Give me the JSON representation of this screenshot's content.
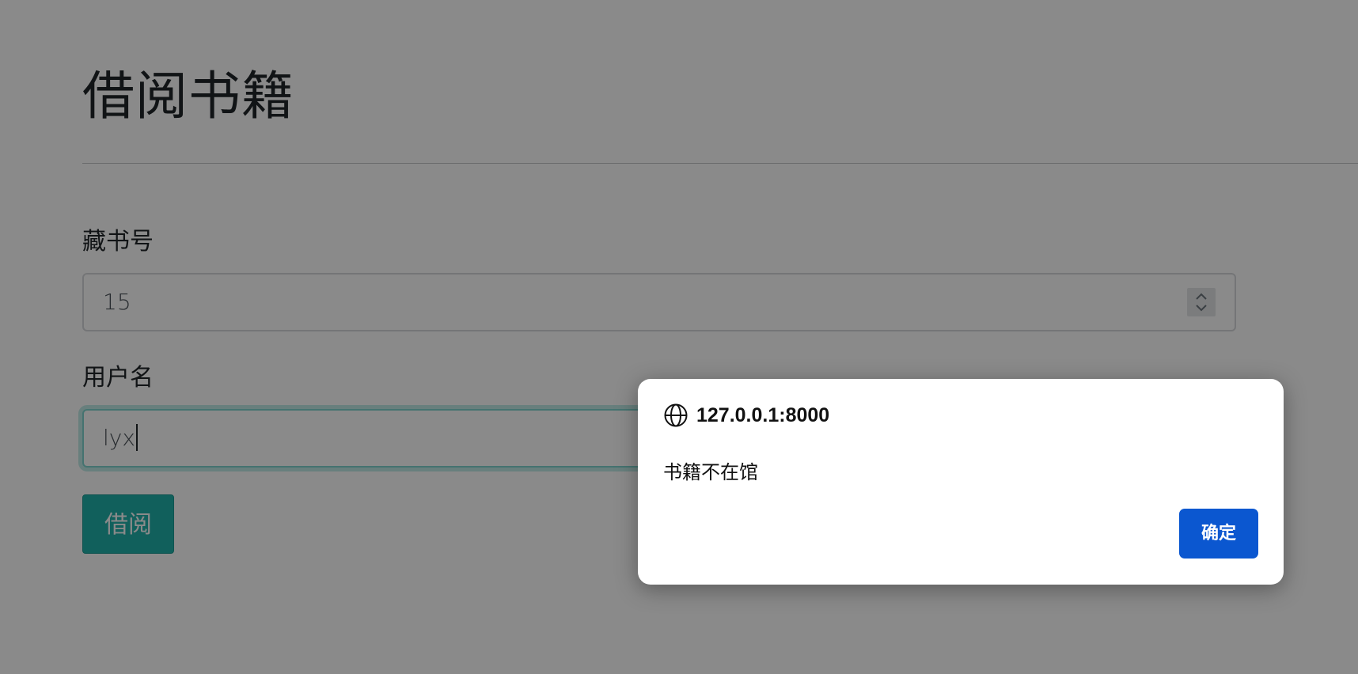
{
  "page": {
    "title": "借阅书籍"
  },
  "form": {
    "book_id": {
      "label": "藏书号",
      "value": "15"
    },
    "username": {
      "label": "用户名",
      "value": "lyx"
    },
    "submit_label": "借阅"
  },
  "dialog": {
    "origin": "127.0.0.1:8000",
    "message": "书籍不在馆",
    "ok_label": "确定"
  },
  "colors": {
    "accent": "#20b2aa",
    "dialog_button": "#0b57d0"
  }
}
